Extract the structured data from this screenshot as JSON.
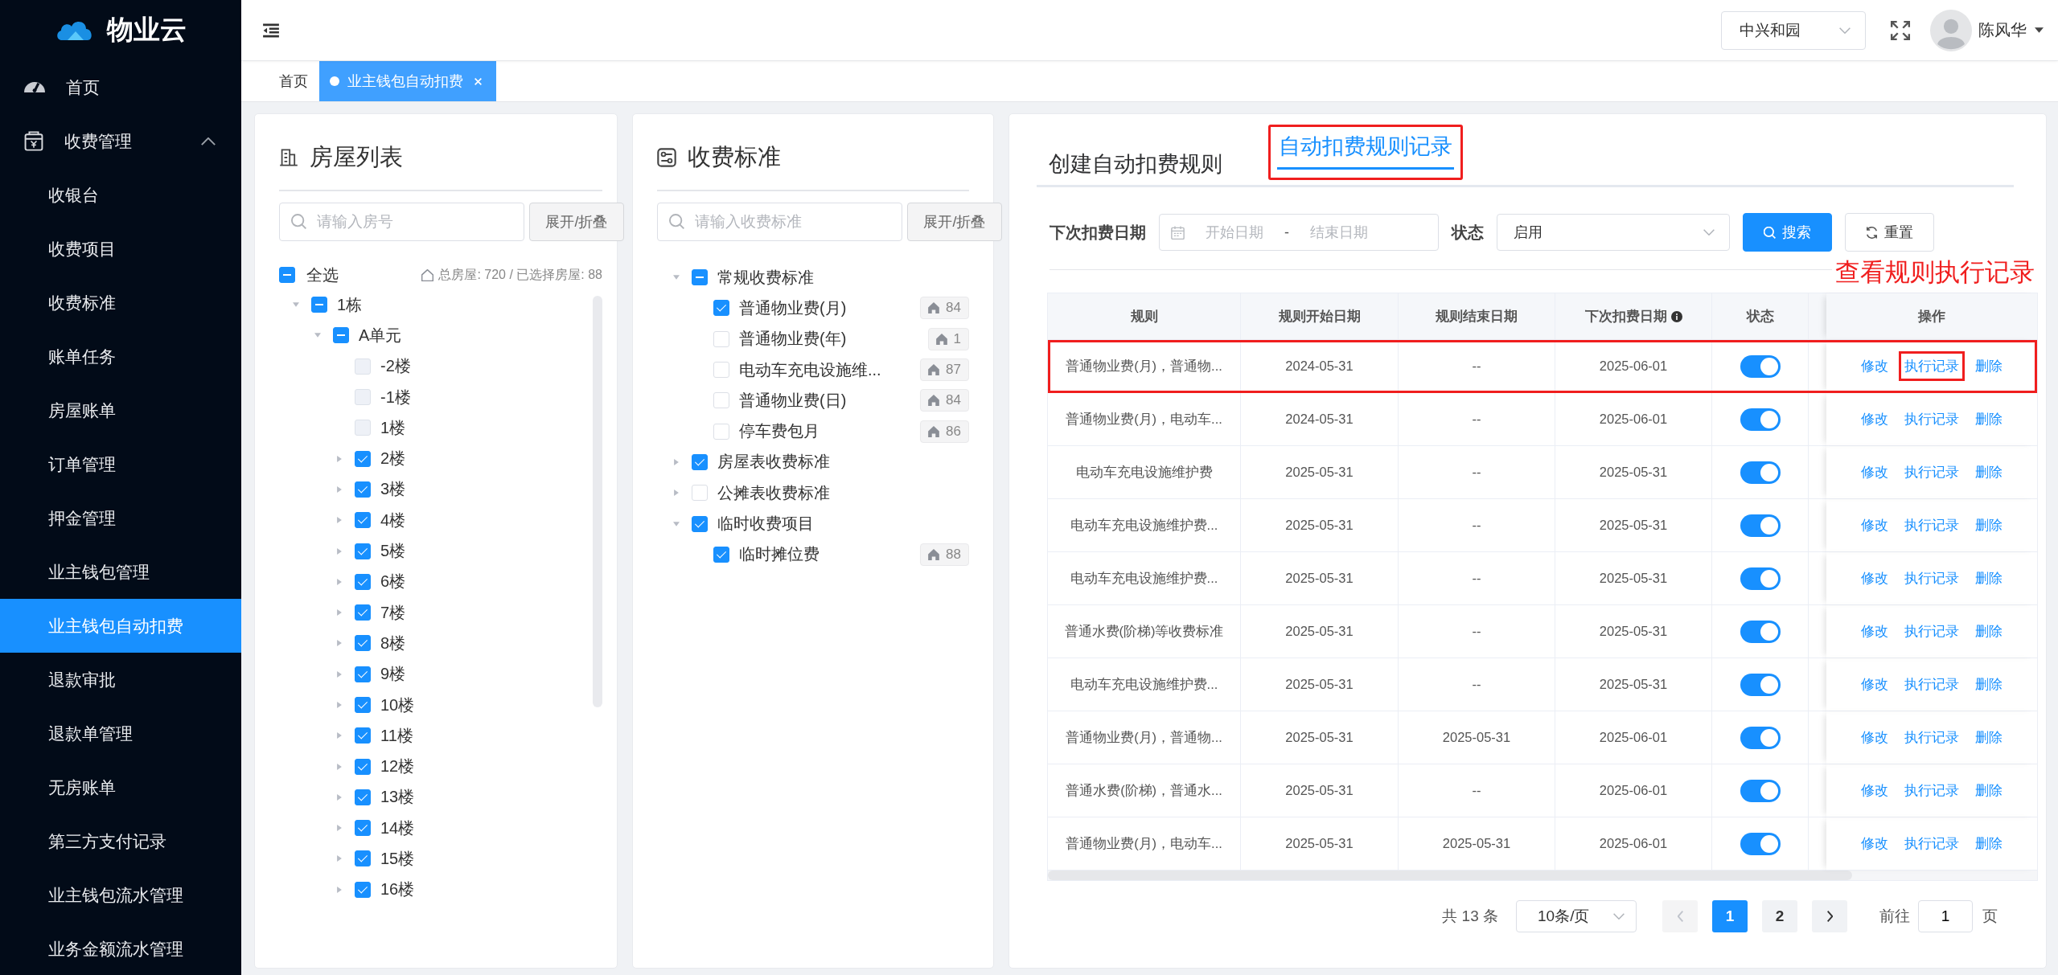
{
  "sidebar": {
    "logo": "物业云",
    "items": [
      {
        "label": "首页",
        "kind": "link",
        "selected": false
      },
      {
        "label": "收费管理",
        "kind": "group",
        "expanded": true,
        "selected": false,
        "children": [
          {
            "label": "收银台",
            "selected": false
          },
          {
            "label": "收费项目",
            "selected": false
          },
          {
            "label": "收费标准",
            "selected": false
          },
          {
            "label": "账单任务",
            "selected": false
          },
          {
            "label": "房屋账单",
            "selected": false
          },
          {
            "label": "订单管理",
            "selected": false
          },
          {
            "label": "押金管理",
            "selected": false
          },
          {
            "label": "业主钱包管理",
            "selected": false
          },
          {
            "label": "业主钱包自动扣费",
            "selected": true
          },
          {
            "label": "退款审批",
            "selected": false
          },
          {
            "label": "退款单管理",
            "selected": false
          },
          {
            "label": "无房账单",
            "selected": false
          },
          {
            "label": "第三方支付记录",
            "selected": false
          },
          {
            "label": "业主钱包流水管理",
            "selected": false
          },
          {
            "label": "业务金额流水管理",
            "selected": false
          }
        ]
      }
    ]
  },
  "header": {
    "community": "中兴和园",
    "user": "陈风华"
  },
  "page_tabs": [
    {
      "label": "首页",
      "selected": false
    },
    {
      "label": "业主钱包自动扣费",
      "selected": true
    }
  ],
  "house_list": {
    "title": "房屋列表",
    "search": {
      "placeholder": "请输入房号"
    },
    "toggle_button": "展开/折叠",
    "select_all": {
      "label": "全选",
      "checked": false,
      "indeterminate": true
    },
    "summary": "总房屋: 720 / 已选择房屋: 88",
    "tree": [
      {
        "label": "1栋",
        "expanded": true,
        "checked": false,
        "indeterminate": true,
        "children": [
          {
            "label": "A单元",
            "expanded": true,
            "checked": false,
            "indeterminate": true,
            "children": [
              {
                "label": "-2楼",
                "checked": false,
                "disabled": true
              },
              {
                "label": "-1楼",
                "checked": false,
                "disabled": true
              },
              {
                "label": "1楼",
                "checked": false,
                "disabled": true
              },
              {
                "label": "2楼",
                "expanded": false,
                "checked": true,
                "disabled": false
              },
              {
                "label": "3楼",
                "expanded": false,
                "checked": true,
                "disabled": false
              },
              {
                "label": "4楼",
                "expanded": false,
                "checked": true,
                "disabled": false
              },
              {
                "label": "5楼",
                "expanded": false,
                "checked": true,
                "disabled": false
              },
              {
                "label": "6楼",
                "expanded": false,
                "checked": true,
                "disabled": false
              },
              {
                "label": "7楼",
                "expanded": false,
                "checked": true,
                "disabled": false
              },
              {
                "label": "8楼",
                "expanded": false,
                "checked": true,
                "disabled": false
              },
              {
                "label": "9楼",
                "expanded": false,
                "checked": true,
                "disabled": false
              },
              {
                "label": "10楼",
                "expanded": false,
                "checked": true,
                "disabled": false
              },
              {
                "label": "11楼",
                "expanded": false,
                "checked": true,
                "disabled": false
              },
              {
                "label": "12楼",
                "expanded": false,
                "checked": true,
                "disabled": false
              },
              {
                "label": "13楼",
                "expanded": false,
                "checked": true,
                "disabled": false
              },
              {
                "label": "14楼",
                "expanded": false,
                "checked": true,
                "disabled": false
              },
              {
                "label": "15楼",
                "expanded": false,
                "checked": true,
                "disabled": false
              },
              {
                "label": "16楼",
                "expanded": false,
                "checked": true,
                "disabled": false
              }
            ]
          }
        ]
      }
    ]
  },
  "fee_standards": {
    "title": "收费标准",
    "search": {
      "placeholder": "请输入收费标准"
    },
    "toggle_button": "展开/折叠",
    "groups": [
      {
        "label": "常规收费标准",
        "expanded": true,
        "checked": false,
        "indeterminate": true,
        "children": [
          {
            "label": "普通物业费(月)",
            "checked": true,
            "count": "84"
          },
          {
            "label": "普通物业费(年)",
            "checked": false,
            "count": "1"
          },
          {
            "label": "电动车充电设施维...",
            "checked": false,
            "count": "87"
          },
          {
            "label": "普通物业费(日)",
            "checked": false,
            "count": "84"
          },
          {
            "label": "停车费包月",
            "checked": false,
            "count": "86"
          }
        ]
      },
      {
        "label": "房屋表收费标准",
        "expanded": false,
        "checked": true,
        "indeterminate": false
      },
      {
        "label": "公摊表收费标准",
        "expanded": false,
        "checked": false,
        "indeterminate": false
      },
      {
        "label": "临时收费项目",
        "expanded": true,
        "checked": true,
        "indeterminate": false,
        "children": [
          {
            "label": "临时摊位费",
            "checked": true,
            "count": "88"
          }
        ]
      }
    ]
  },
  "rules": {
    "tabs": [
      {
        "label": "创建自动扣费规则",
        "selected": false,
        "highlighted": false
      },
      {
        "label": "自动扣费规则记录",
        "selected": true,
        "highlighted": true
      }
    ],
    "filters": {
      "date_label": "下次扣费日期",
      "start_placeholder": "开始日期",
      "range_separator": "-",
      "end_placeholder": "结束日期",
      "status_label": "状态",
      "status_value": "启用",
      "search_button": "搜索",
      "reset_button": "重置"
    },
    "annotation": "查看规则执行记录",
    "table": {
      "columns": [
        {
          "label": "规则",
          "info": false
        },
        {
          "label": "规则开始日期",
          "info": false
        },
        {
          "label": "规则结束日期",
          "info": false
        },
        {
          "label": "下次扣费日期",
          "info": true
        },
        {
          "label": "状态",
          "info": false
        },
        {
          "label": "操作",
          "info": false
        }
      ],
      "rows": [
        {
          "rule": "普通物业费(月)，普通物...",
          "start": "2024-05-31",
          "end": "--",
          "next": "2025-06-01",
          "enabled": true,
          "highlighted": true,
          "actions": [
            {
              "label": "修改",
              "highlighted": false
            },
            {
              "label": "执行记录",
              "highlighted": true
            },
            {
              "label": "删除",
              "highlighted": false
            }
          ]
        },
        {
          "rule": "普通物业费(月)，电动车...",
          "start": "2024-05-31",
          "end": "--",
          "next": "2025-06-01",
          "enabled": true,
          "highlighted": false,
          "actions": [
            {
              "label": "修改",
              "highlighted": false
            },
            {
              "label": "执行记录",
              "highlighted": false
            },
            {
              "label": "删除",
              "highlighted": false
            }
          ]
        },
        {
          "rule": "电动车充电设施维护费",
          "start": "2025-05-31",
          "end": "--",
          "next": "2025-05-31",
          "enabled": true,
          "highlighted": false,
          "actions": [
            {
              "label": "修改",
              "highlighted": false
            },
            {
              "label": "执行记录",
              "highlighted": false
            },
            {
              "label": "删除",
              "highlighted": false
            }
          ]
        },
        {
          "rule": "电动车充电设施维护费...",
          "start": "2025-05-31",
          "end": "--",
          "next": "2025-05-31",
          "enabled": true,
          "highlighted": false,
          "actions": [
            {
              "label": "修改",
              "highlighted": false
            },
            {
              "label": "执行记录",
              "highlighted": false
            },
            {
              "label": "删除",
              "highlighted": false
            }
          ]
        },
        {
          "rule": "电动车充电设施维护费...",
          "start": "2025-05-31",
          "end": "--",
          "next": "2025-05-31",
          "enabled": true,
          "highlighted": false,
          "actions": [
            {
              "label": "修改",
              "highlighted": false
            },
            {
              "label": "执行记录",
              "highlighted": false
            },
            {
              "label": "删除",
              "highlighted": false
            }
          ]
        },
        {
          "rule": "普通水费(阶梯)等收费标准",
          "start": "2025-05-31",
          "end": "--",
          "next": "2025-05-31",
          "enabled": true,
          "highlighted": false,
          "actions": [
            {
              "label": "修改",
              "highlighted": false
            },
            {
              "label": "执行记录",
              "highlighted": false
            },
            {
              "label": "删除",
              "highlighted": false
            }
          ]
        },
        {
          "rule": "电动车充电设施维护费...",
          "start": "2025-05-31",
          "end": "--",
          "next": "2025-05-31",
          "enabled": true,
          "highlighted": false,
          "actions": [
            {
              "label": "修改",
              "highlighted": false
            },
            {
              "label": "执行记录",
              "highlighted": false
            },
            {
              "label": "删除",
              "highlighted": false
            }
          ]
        },
        {
          "rule": "普通物业费(月)，普通物...",
          "start": "2025-05-31",
          "end": "2025-05-31",
          "next": "2025-06-01",
          "enabled": true,
          "highlighted": false,
          "actions": [
            {
              "label": "修改",
              "highlighted": false
            },
            {
              "label": "执行记录",
              "highlighted": false
            },
            {
              "label": "删除",
              "highlighted": false
            }
          ]
        },
        {
          "rule": "普通水费(阶梯)，普通水...",
          "start": "2025-05-31",
          "end": "--",
          "next": "2025-06-01",
          "enabled": true,
          "highlighted": false,
          "actions": [
            {
              "label": "修改",
              "highlighted": false
            },
            {
              "label": "执行记录",
              "highlighted": false
            },
            {
              "label": "删除",
              "highlighted": false
            }
          ]
        },
        {
          "rule": "普通物业费(月)，电动车...",
          "start": "2025-05-31",
          "end": "2025-05-31",
          "next": "2025-06-01",
          "enabled": true,
          "highlighted": false,
          "actions": [
            {
              "label": "修改",
              "highlighted": false
            },
            {
              "label": "执行记录",
              "highlighted": false
            },
            {
              "label": "删除",
              "highlighted": false
            }
          ]
        }
      ]
    },
    "pagination": {
      "total": "共 13 条",
      "page_size": "10条/页",
      "prev_disabled": true,
      "pages": [
        {
          "label": "1",
          "selected": true
        },
        {
          "label": "2",
          "selected": false
        }
      ],
      "goto_label": "前往",
      "goto_value": "1",
      "goto_suffix": "页"
    }
  }
}
